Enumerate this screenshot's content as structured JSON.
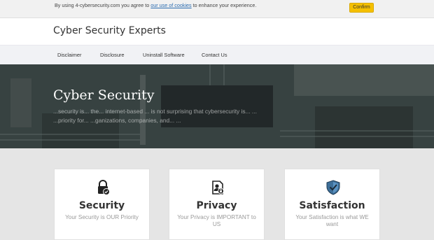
{
  "cookie_bar": {
    "text_before": "By using 4-cybersecurity.com you agree to ",
    "link_text": "our use of cookies",
    "text_after": " to enhance your experience.",
    "confirm_label": "Confirm"
  },
  "header": {
    "title": "Cyber Security Experts"
  },
  "nav": {
    "items": [
      {
        "label": "Disclaimer"
      },
      {
        "label": "Disclosure"
      },
      {
        "label": "Uninstall Software"
      },
      {
        "label": "Contact Us"
      }
    ]
  },
  "hero": {
    "title": "Cyber Security",
    "line1": "...security is... the... internet-based ... is not surprising that cybersecurity is... ...",
    "line2": "...priority for... ...ganizations, companies, and... ..."
  },
  "features": [
    {
      "title": "Security",
      "subtitle": "Your Security is OUR Priority",
      "icon": "lock-check-icon"
    },
    {
      "title": "Privacy",
      "subtitle": "Your Privacy is IMPORTANT to US",
      "icon": "privacy-document-icon"
    },
    {
      "title": "Satisfaction",
      "subtitle": "Your Satisfaction is what WE want",
      "icon": "shield-check-icon"
    }
  ],
  "colors": {
    "confirm_button": "#f5c000",
    "link": "#2b6cb0",
    "nav_background": "#f1f2f5"
  }
}
